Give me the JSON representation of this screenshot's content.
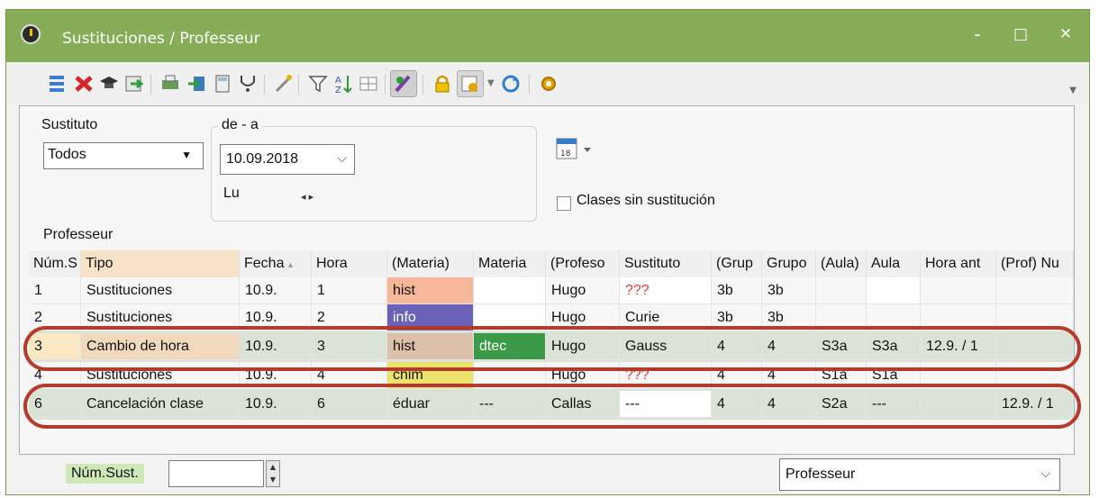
{
  "window": {
    "title": "Sustituciones / Professeur",
    "controls": [
      "-",
      "□",
      "✕"
    ]
  },
  "toolbar": {
    "icons": [
      "list-icon",
      "delete-icon",
      "graduation-cap-icon",
      "export-icon",
      "print-icon",
      "import-icon",
      "calculator-icon",
      "stethoscope-icon",
      "magic-icon",
      "filter-icon",
      "sort-icon",
      "columns-icon",
      "edit-icon",
      "lock-icon",
      "settings-folder-icon",
      "refresh-icon",
      "gear-icon"
    ]
  },
  "filters": {
    "substitute_label": "Sustituto",
    "substitute_value": "Todos",
    "range_label": "de - a",
    "date_value": "10.09.2018",
    "day_label": "Lu",
    "calendar_arrows": "◂ ▸",
    "no_substitution_label": "Clases sin sustitución",
    "section_label": "Professeur"
  },
  "table": {
    "headers": [
      "Núm.S",
      "Tipo",
      "Fecha",
      "Hora",
      "(Materia)",
      "Materia",
      "(Profeso",
      "Sustituto",
      "(Grup",
      "Grupo",
      "(Aula)",
      "Aula",
      "Hora ant",
      "(Prof) Nu"
    ],
    "rows": [
      [
        "1",
        "Sustituciones",
        "10.9.",
        "1",
        "hist",
        "",
        "Hugo",
        "???",
        "3b",
        "3b",
        "",
        "",
        "",
        ""
      ],
      [
        "2",
        "Sustituciones",
        "10.9.",
        "2",
        "info",
        "",
        "Hugo",
        "Curie",
        "3b",
        "3b",
        "",
        "",
        "",
        ""
      ],
      [
        "3",
        "Cambio de hora",
        "10.9.",
        "3",
        "hist",
        "dtec",
        "Hugo",
        "Gauss",
        "4",
        "4",
        "S3a",
        "S3a",
        "12.9. / 1",
        ""
      ],
      [
        "4",
        "Sustituciones",
        "10.9.",
        "4",
        "chim",
        "",
        "Hugo",
        "???",
        "4",
        "4",
        "S1a",
        "S1a",
        "",
        ""
      ],
      [
        "6",
        "Cancelación clase",
        "10.9.",
        "6",
        "éduar",
        "---",
        "Callas",
        "---",
        "4",
        "4",
        "S2a",
        "---",
        "",
        "12.9. / 1"
      ]
    ]
  },
  "footer": {
    "num_label": "Núm.Sust.",
    "num_value": "",
    "view_value": "Professeur"
  },
  "colors": {
    "title_bar": "#88ad58",
    "highlight": "#b43a2a",
    "hist": "#f7b79a",
    "info": "#6a62b8",
    "chim": "#ede36a",
    "dtec": "#3a9a48",
    "tipo_col": "#f8e3c8",
    "warning": "#e53935"
  }
}
